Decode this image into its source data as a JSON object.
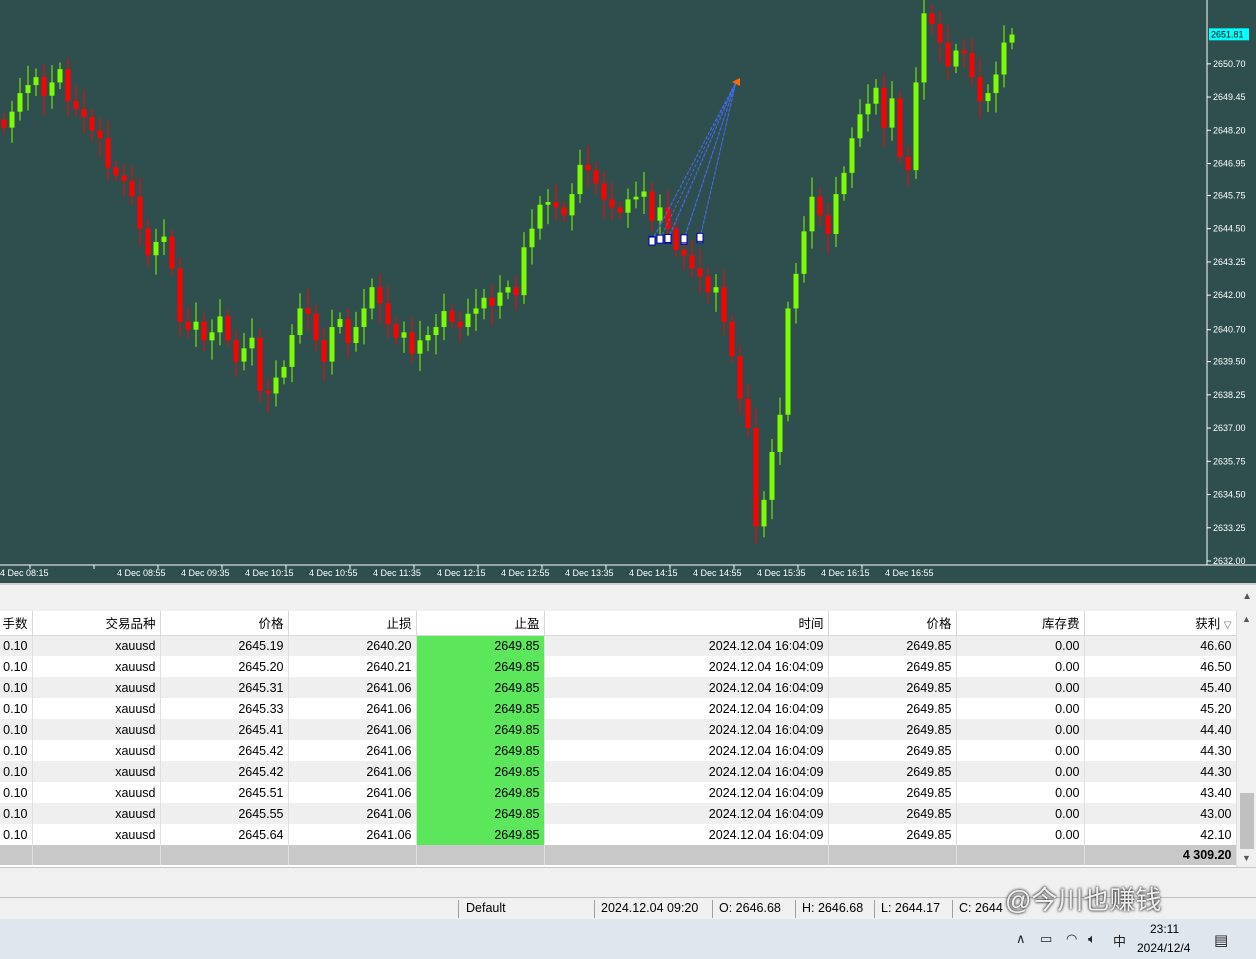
{
  "chart_data": {
    "type": "candlestick",
    "symbol": "xauusd",
    "ylim": [
      2632.0,
      2652.8
    ],
    "y_ticks": [
      "2650.70",
      "2649.45",
      "2648.20",
      "2646.95",
      "2645.75",
      "2644.50",
      "2643.25",
      "2642.00",
      "2640.70",
      "2639.50",
      "2638.25",
      "2637.00",
      "2635.75",
      "2634.50",
      "2633.25",
      "2632.00"
    ],
    "current_price_label": "2651.81",
    "x_ticks": [
      "4 Dec 08:15",
      "4 Dec 08:55",
      "4 Dec 09:35",
      "4 Dec 10:15",
      "4 Dec 10:55",
      "4 Dec 11:35",
      "4 Dec 12:15",
      "4 Dec 12:55",
      "4 Dec 13:35",
      "4 Dec 14:15",
      "4 Dec 14:55",
      "4 Dec 15:35",
      "4 Dec 16:15",
      "4 Dec 16:55"
    ],
    "colors": {
      "background": "#2f4f4f",
      "bull": "#7cfc00",
      "bear": "#ff0000",
      "trade_line": "#4169e1",
      "text": "#ffffff"
    },
    "closes": [
      2648.3,
      2648.9,
      2649.6,
      2649.9,
      2650.2,
      2649.5,
      2650.0,
      2650.5,
      2649.3,
      2649.0,
      2648.7,
      2648.2,
      2647.9,
      2646.8,
      2646.5,
      2646.3,
      2645.7,
      2644.5,
      2643.5,
      2644.0,
      2644.2,
      2643.0,
      2641.0,
      2640.7,
      2641.0,
      2640.3,
      2640.6,
      2641.2,
      2640.3,
      2639.5,
      2640.0,
      2640.4,
      2638.4,
      2638.3,
      2638.9,
      2639.3,
      2640.5,
      2641.5,
      2641.3,
      2640.3,
      2639.5,
      2640.8,
      2641.1,
      2640.2,
      2640.8,
      2641.5,
      2642.3,
      2641.7,
      2640.9,
      2640.4,
      2640.6,
      2639.8,
      2640.3,
      2640.5,
      2640.8,
      2641.4,
      2641.0,
      2640.8,
      2641.3,
      2641.5,
      2641.9,
      2641.6,
      2642.1,
      2642.3,
      2642.0,
      2643.8,
      2644.5,
      2645.4,
      2645.5,
      2645.3,
      2645.0,
      2645.8,
      2646.9,
      2646.7,
      2646.2,
      2645.6,
      2645.3,
      2645.1,
      2645.6,
      2645.7,
      2645.9,
      2644.8,
      2645.3,
      2644.5,
      2643.7,
      2643.5,
      2643.0,
      2642.7,
      2642.1,
      2642.3,
      2641.0,
      2639.7,
      2638.1,
      2637.0,
      2633.3,
      2634.3,
      2636.1,
      2637.5,
      2641.5,
      2642.8,
      2644.4,
      2645.7,
      2645.0,
      2644.3,
      2645.8,
      2646.6,
      2647.9,
      2648.8,
      2649.2,
      2649.8,
      2648.3,
      2649.4,
      2647.2,
      2646.7,
      2650.0,
      2652.6,
      2652.2,
      2651.5,
      2650.6,
      2651.2,
      2651.1,
      2650.2,
      2649.3,
      2649.6,
      2650.3,
      2651.5,
      2651.8
    ]
  },
  "table": {
    "headers": [
      "手数",
      "交易品种",
      "价格",
      "止损",
      "止盈",
      "时间",
      "价格",
      "库存费",
      "获利"
    ],
    "sort_indicator": "▽",
    "rows": [
      [
        "0.10",
        "xauusd",
        "2645.19",
        "2640.20",
        "2649.85",
        "2024.12.04 16:04:09",
        "2649.85",
        "0.00",
        "46.60"
      ],
      [
        "0.10",
        "xauusd",
        "2645.20",
        "2640.21",
        "2649.85",
        "2024.12.04 16:04:09",
        "2649.85",
        "0.00",
        "46.50"
      ],
      [
        "0.10",
        "xauusd",
        "2645.31",
        "2641.06",
        "2649.85",
        "2024.12.04 16:04:09",
        "2649.85",
        "0.00",
        "45.40"
      ],
      [
        "0.10",
        "xauusd",
        "2645.33",
        "2641.06",
        "2649.85",
        "2024.12.04 16:04:09",
        "2649.85",
        "0.00",
        "45.20"
      ],
      [
        "0.10",
        "xauusd",
        "2645.41",
        "2641.06",
        "2649.85",
        "2024.12.04 16:04:09",
        "2649.85",
        "0.00",
        "44.40"
      ],
      [
        "0.10",
        "xauusd",
        "2645.42",
        "2641.06",
        "2649.85",
        "2024.12.04 16:04:09",
        "2649.85",
        "0.00",
        "44.30"
      ],
      [
        "0.10",
        "xauusd",
        "2645.42",
        "2641.06",
        "2649.85",
        "2024.12.04 16:04:09",
        "2649.85",
        "0.00",
        "44.30"
      ],
      [
        "0.10",
        "xauusd",
        "2645.51",
        "2641.06",
        "2649.85",
        "2024.12.04 16:04:09",
        "2649.85",
        "0.00",
        "43.40"
      ],
      [
        "0.10",
        "xauusd",
        "2645.55",
        "2641.06",
        "2649.85",
        "2024.12.04 16:04:09",
        "2649.85",
        "0.00",
        "43.00"
      ],
      [
        "0.10",
        "xauusd",
        "2645.64",
        "2641.06",
        "2649.85",
        "2024.12.04 16:04:09",
        "2649.85",
        "0.00",
        "42.10"
      ]
    ],
    "total_profit": "4 309.20"
  },
  "status_bar": {
    "profile": "Default",
    "datetime": "2024.12.04 09:20",
    "open": "O: 2646.68",
    "high": "H: 2646.68",
    "low": "L: 2644.17",
    "close": "C: 2644"
  },
  "taskbar": {
    "time": "23:11",
    "date": "2024/12/4",
    "ime": "中"
  },
  "watermark": "@今川也赚钱"
}
